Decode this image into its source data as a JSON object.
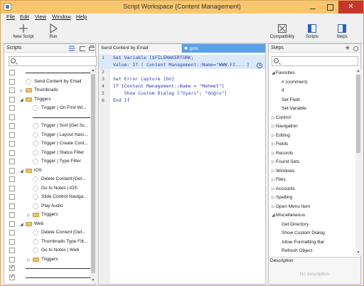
{
  "window": {
    "title": "Script Workspace (Content Management)",
    "close_glyph": "✕"
  },
  "menu": [
    "File",
    "Edit",
    "View",
    "Window",
    "Help"
  ],
  "toolbar": {
    "new_script": "New Script",
    "run": "Run",
    "compatibility": "Compatibility",
    "scripts": "Scripts",
    "steps": "Steps"
  },
  "scripts_panel": {
    "title": "Scripts",
    "search_value": "",
    "rows": [
      {
        "type": "sep",
        "indent": 0,
        "checked": false
      },
      {
        "type": "script",
        "label": "Send Content by Email",
        "indent": 0,
        "checked": false
      },
      {
        "type": "folder",
        "label": "Thumbnails",
        "indent": 0,
        "expanded": false,
        "checked": false
      },
      {
        "type": "folder",
        "label": "Triggers",
        "indent": 0,
        "expanded": true,
        "checked": false
      },
      {
        "type": "script",
        "label": "Trigger | On First Wi...",
        "indent": 1,
        "checked": false
      },
      {
        "type": "sep",
        "indent": 1,
        "checked": false
      },
      {
        "type": "script",
        "label": "Trigger | Sort [Get Sc...",
        "indent": 1,
        "checked": false
      },
      {
        "type": "script",
        "label": "Trigger | Layout Navi...",
        "indent": 1,
        "checked": false
      },
      {
        "type": "script",
        "label": "Trigger | Create Cont...",
        "indent": 1,
        "checked": false
      },
      {
        "type": "script",
        "label": "Trigger | Status Filter",
        "indent": 1,
        "checked": false
      },
      {
        "type": "script",
        "label": "Trigger | Type Filter",
        "indent": 1,
        "checked": false
      },
      {
        "type": "folder",
        "label": "iOS",
        "indent": 0,
        "expanded": true,
        "checked": false
      },
      {
        "type": "script",
        "label": "Delete Content [Get...",
        "indent": 1,
        "checked": false
      },
      {
        "type": "script",
        "label": "Go to Notes | iOS",
        "indent": 1,
        "checked": false
      },
      {
        "type": "script",
        "label": "Slide Control Naviga...",
        "indent": 1,
        "checked": false
      },
      {
        "type": "script",
        "label": "Play Audio",
        "indent": 1,
        "checked": false
      },
      {
        "type": "folder",
        "label": "Triggers",
        "indent": 1,
        "expanded": false,
        "checked": false
      },
      {
        "type": "folder",
        "label": "Web",
        "indent": 0,
        "expanded": true,
        "checked": false
      },
      {
        "type": "script",
        "label": "Delete Content [Get...",
        "indent": 1,
        "checked": false
      },
      {
        "type": "script",
        "label": "Thumbnails Type Filt...",
        "indent": 1,
        "checked": false
      },
      {
        "type": "script",
        "label": "Go to Notes | Web",
        "indent": 1,
        "checked": false
      },
      {
        "type": "folder",
        "label": "Triggers",
        "indent": 1,
        "expanded": false,
        "checked": false
      },
      {
        "type": "sep",
        "indent": 0,
        "checked": true
      },
      {
        "type": "sep",
        "indent": 0,
        "checked": true
      }
    ]
  },
  "editor": {
    "tabs": [
      {
        "label": "Send Content by Email",
        "active": false
      },
      {
        "label": "goto",
        "active": true,
        "star": "✱"
      }
    ],
    "lines": [
      {
        "num": "1",
        "code": "Set Variable [$FILEMAKERTURK;",
        "selected": true
      },
      {
        "num": "",
        "code": "Value: If ( Content Management::Name=\"WWW.FI... ]",
        "selected": true
      },
      {
        "num": "2",
        "code": "",
        "selected": false
      },
      {
        "num": "3",
        "code": "Set Error Capture [On]",
        "selected": false
      },
      {
        "num": "4",
        "code": "If [Content Management::Name = \"Mehmet\"]",
        "selected": false
      },
      {
        "num": "5",
        "code": "    Show Custom Dialog [\"Uyarı\"; \"doğru\"]",
        "selected": false
      },
      {
        "num": "6",
        "code": "End If",
        "selected": false
      }
    ]
  },
  "steps_panel": {
    "title": "Steps",
    "star": "★",
    "search_value": "",
    "rows": [
      {
        "label": "Favorites",
        "kind": "group-open"
      },
      {
        "label": "# (comment)",
        "kind": "item"
      },
      {
        "label": "If",
        "kind": "item"
      },
      {
        "label": "Set Field",
        "kind": "item"
      },
      {
        "label": "Set Variable",
        "kind": "item"
      },
      {
        "label": "Control",
        "kind": "group"
      },
      {
        "label": "Navigation",
        "kind": "group"
      },
      {
        "label": "Editing",
        "kind": "group"
      },
      {
        "label": "Fields",
        "kind": "group"
      },
      {
        "label": "Records",
        "kind": "group"
      },
      {
        "label": "Found Sets",
        "kind": "group"
      },
      {
        "label": "Windows",
        "kind": "group"
      },
      {
        "label": "Files",
        "kind": "group"
      },
      {
        "label": "Accounts",
        "kind": "group"
      },
      {
        "label": "Spelling",
        "kind": "group"
      },
      {
        "label": "Open Menu Item",
        "kind": "group"
      },
      {
        "label": "Miscellaneous",
        "kind": "group-open"
      },
      {
        "label": "Get Directory",
        "kind": "item"
      },
      {
        "label": "Show Custom Dialog",
        "kind": "item"
      },
      {
        "label": "Allow Formatting Bar",
        "kind": "item"
      },
      {
        "label": "Refresh Object",
        "kind": "item"
      }
    ],
    "description_title": "Description",
    "description_empty": "No description"
  }
}
